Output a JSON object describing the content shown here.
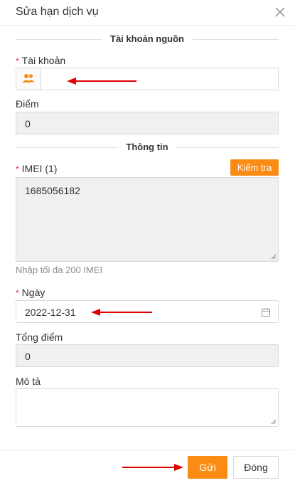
{
  "dialog": {
    "title": "Sửa hạn dịch vụ",
    "close_icon": "close-icon"
  },
  "section_source": {
    "heading": "Tài khoản nguồn"
  },
  "account": {
    "required_mark": "*",
    "label": "Tài khoản",
    "value": "",
    "icon": "users-icon",
    "icon_color": "#fa8c16"
  },
  "points": {
    "label": "Điểm",
    "value": "0"
  },
  "section_info": {
    "heading": "Thông tin"
  },
  "imei": {
    "required_mark": "*",
    "label": "IMEI (1)",
    "value": "1685056182",
    "check_button": "Kiểm tra",
    "hint": "Nhập tối đa 200 IMEI"
  },
  "date": {
    "required_mark": "*",
    "label": "Ngày",
    "value": "2022-12-31",
    "icon": "calendar-icon"
  },
  "total_points": {
    "label": "Tổng điểm",
    "value": "0"
  },
  "description": {
    "label": "Mô tả",
    "value": ""
  },
  "footer": {
    "submit": "Gửi",
    "close": "Đóng"
  },
  "colors": {
    "accent": "#fa8c16",
    "required": "#f5222d",
    "annotation_arrow": "#e00000"
  }
}
